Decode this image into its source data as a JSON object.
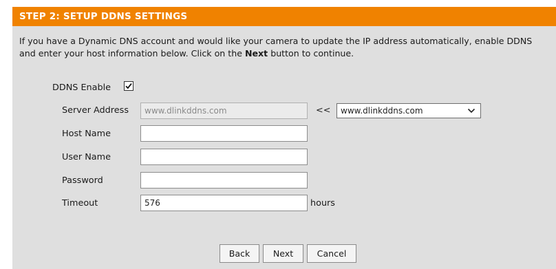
{
  "header": {
    "title": "STEP 2: SETUP DDNS SETTINGS"
  },
  "intro": {
    "before_bold": "If you have a Dynamic DNS account and would like your camera to update the IP address automatically, enable DDNS and enter your host information below. Click on the ",
    "bold": "Next",
    "after_bold": " button to continue."
  },
  "form": {
    "ddns_enable_label": "DDNS Enable",
    "ddns_enabled": true,
    "server_address_label": "Server Address",
    "server_address_value": "www.dlinkddns.com",
    "copy_arrows": "<<",
    "server_select_value": "www.dlinkddns.com",
    "host_name_label": "Host Name",
    "host_name_value": "",
    "user_name_label": "User Name",
    "user_name_value": "",
    "password_label": "Password",
    "password_value": "",
    "timeout_label": "Timeout",
    "timeout_value": "576",
    "timeout_unit": "hours"
  },
  "buttons": {
    "back": "Back",
    "next": "Next",
    "cancel": "Cancel"
  },
  "colors": {
    "header_bg": "#f08200",
    "panel_bg": "#dfdfdf"
  }
}
